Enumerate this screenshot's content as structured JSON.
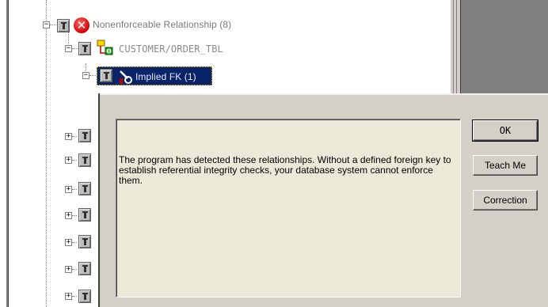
{
  "tree": {
    "root_item": {
      "label": "Nonenforceable Relationship (8)",
      "icon": "error-x-icon"
    },
    "child_item": {
      "label": "CUSTOMER/ORDER_TBL",
      "icon": "table-relation-icon"
    },
    "grandchild_item": {
      "label": "Implied FK (1)",
      "icon": "implied-fk-icon",
      "selected": true
    },
    "collapsed_rows": 7
  },
  "dialog": {
    "message": "The program has detected these relationships.  Without a defined foreign key to establish referential integrity checks, your database system cannot enforce them.",
    "buttons": {
      "ok": "OK",
      "teach_me": "Teach Me",
      "correction": "Correction"
    }
  },
  "colors": {
    "selection": "#0a246a",
    "dialog_face": "#d4d0c8",
    "panel": "#ece9d8",
    "grey_pane": "#808080"
  }
}
